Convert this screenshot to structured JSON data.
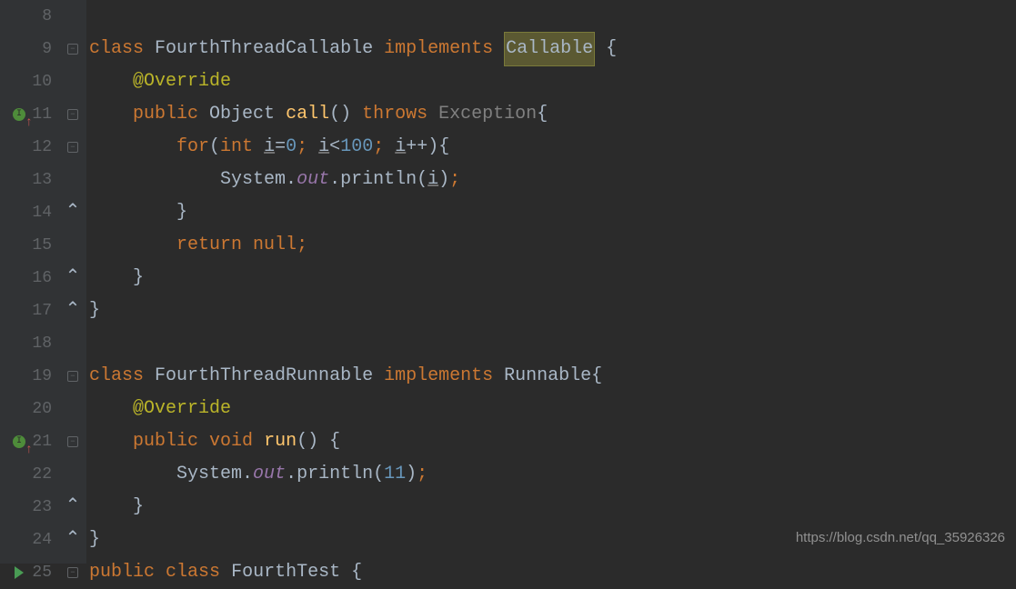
{
  "lineNumbers": [
    "8",
    "9",
    "10",
    "11",
    "12",
    "13",
    "14",
    "15",
    "16",
    "17",
    "18",
    "19",
    "20",
    "21",
    "22",
    "23",
    "24",
    "25"
  ],
  "code": {
    "kw_class": "class",
    "kw_implements": "implements",
    "kw_public": "public",
    "kw_void": "void",
    "kw_for": "for",
    "kw_int": "int",
    "kw_return": "return",
    "kw_null": "null",
    "kw_throws": "throws",
    "annot_override": "@Override",
    "cls1": "FourthThreadCallable",
    "cls2": "FourthThreadRunnable",
    "cls3": "FourthTest",
    "iface_callable": "Callable",
    "iface_runnable": "Runnable",
    "type_object": "Object",
    "type_exception": "Exception",
    "method_call": "call",
    "method_run": "run",
    "method_println": "println",
    "sys": "System",
    "out": "out",
    "var_i": "i",
    "num_0": "0",
    "num_100": "100",
    "num_11": "11",
    "op_assign": "=",
    "op_lt": "<",
    "op_inc": "++",
    "brace_open": "{",
    "brace_close": "}",
    "paren_open": "(",
    "paren_close": ")",
    "paren_empty": "()",
    "semi": ";",
    "dot": "."
  },
  "watermark": "https://blog.csdn.net/qq_35926326"
}
